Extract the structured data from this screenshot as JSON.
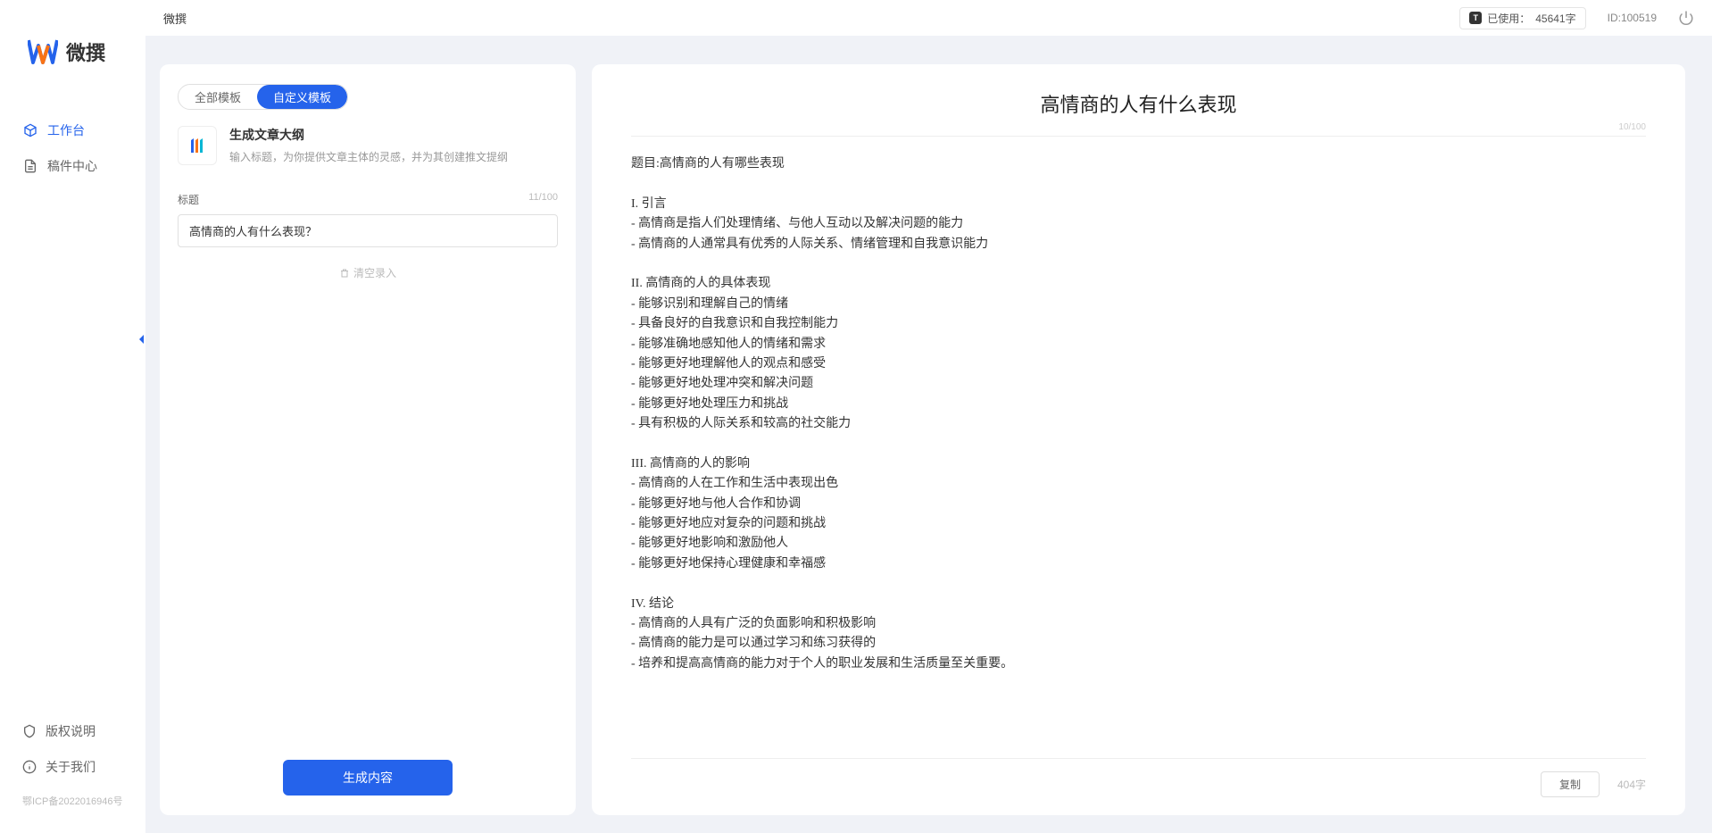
{
  "brand": {
    "name": "微撰"
  },
  "topbar": {
    "title": "微撰",
    "usage_label": "已使用：",
    "usage_value": "45641字",
    "id_label": "ID:100519"
  },
  "sidebar": {
    "nav": [
      {
        "label": "工作台",
        "active": true
      },
      {
        "label": "稿件中心",
        "active": false
      }
    ],
    "footer": [
      {
        "label": "版权说明"
      },
      {
        "label": "关于我们"
      }
    ],
    "license": "鄂ICP备2022016946号"
  },
  "left_panel": {
    "tabs": [
      {
        "label": "全部模板",
        "active": false
      },
      {
        "label": "自定义模板",
        "active": true
      }
    ],
    "template": {
      "title": "生成文章大纲",
      "desc": "输入标题，为你提供文章主体的灵感，并为其创建推文提纲"
    },
    "field_label": "标题",
    "field_count": "11/100",
    "title_value": "高情商的人有什么表现？",
    "clear_label": "清空录入",
    "generate_label": "生成内容"
  },
  "output": {
    "title": "高情商的人有什么表现",
    "title_count": "10/100",
    "body": "题目:高情商的人有哪些表现\n\nI. 引言\n- 高情商是指人们处理情绪、与他人互动以及解决问题的能力\n- 高情商的人通常具有优秀的人际关系、情绪管理和自我意识能力\n\nII. 高情商的人的具体表现\n- 能够识别和理解自己的情绪\n- 具备良好的自我意识和自我控制能力\n- 能够准确地感知他人的情绪和需求\n- 能够更好地理解他人的观点和感受\n- 能够更好地处理冲突和解决问题\n- 能够更好地处理压力和挑战\n- 具有积极的人际关系和较高的社交能力\n\nIII. 高情商的人的影响\n- 高情商的人在工作和生活中表现出色\n- 能够更好地与他人合作和协调\n- 能够更好地应对复杂的问题和挑战\n- 能够更好地影响和激励他人\n- 能够更好地保持心理健康和幸福感\n\nIV. 结论\n- 高情商的人具有广泛的负面影响和积极影响\n- 高情商的能力是可以通过学习和练习获得的\n- 培养和提高高情商的能力对于个人的职业发展和生活质量至关重要。",
    "copy_label": "复制",
    "word_count": "404字"
  }
}
